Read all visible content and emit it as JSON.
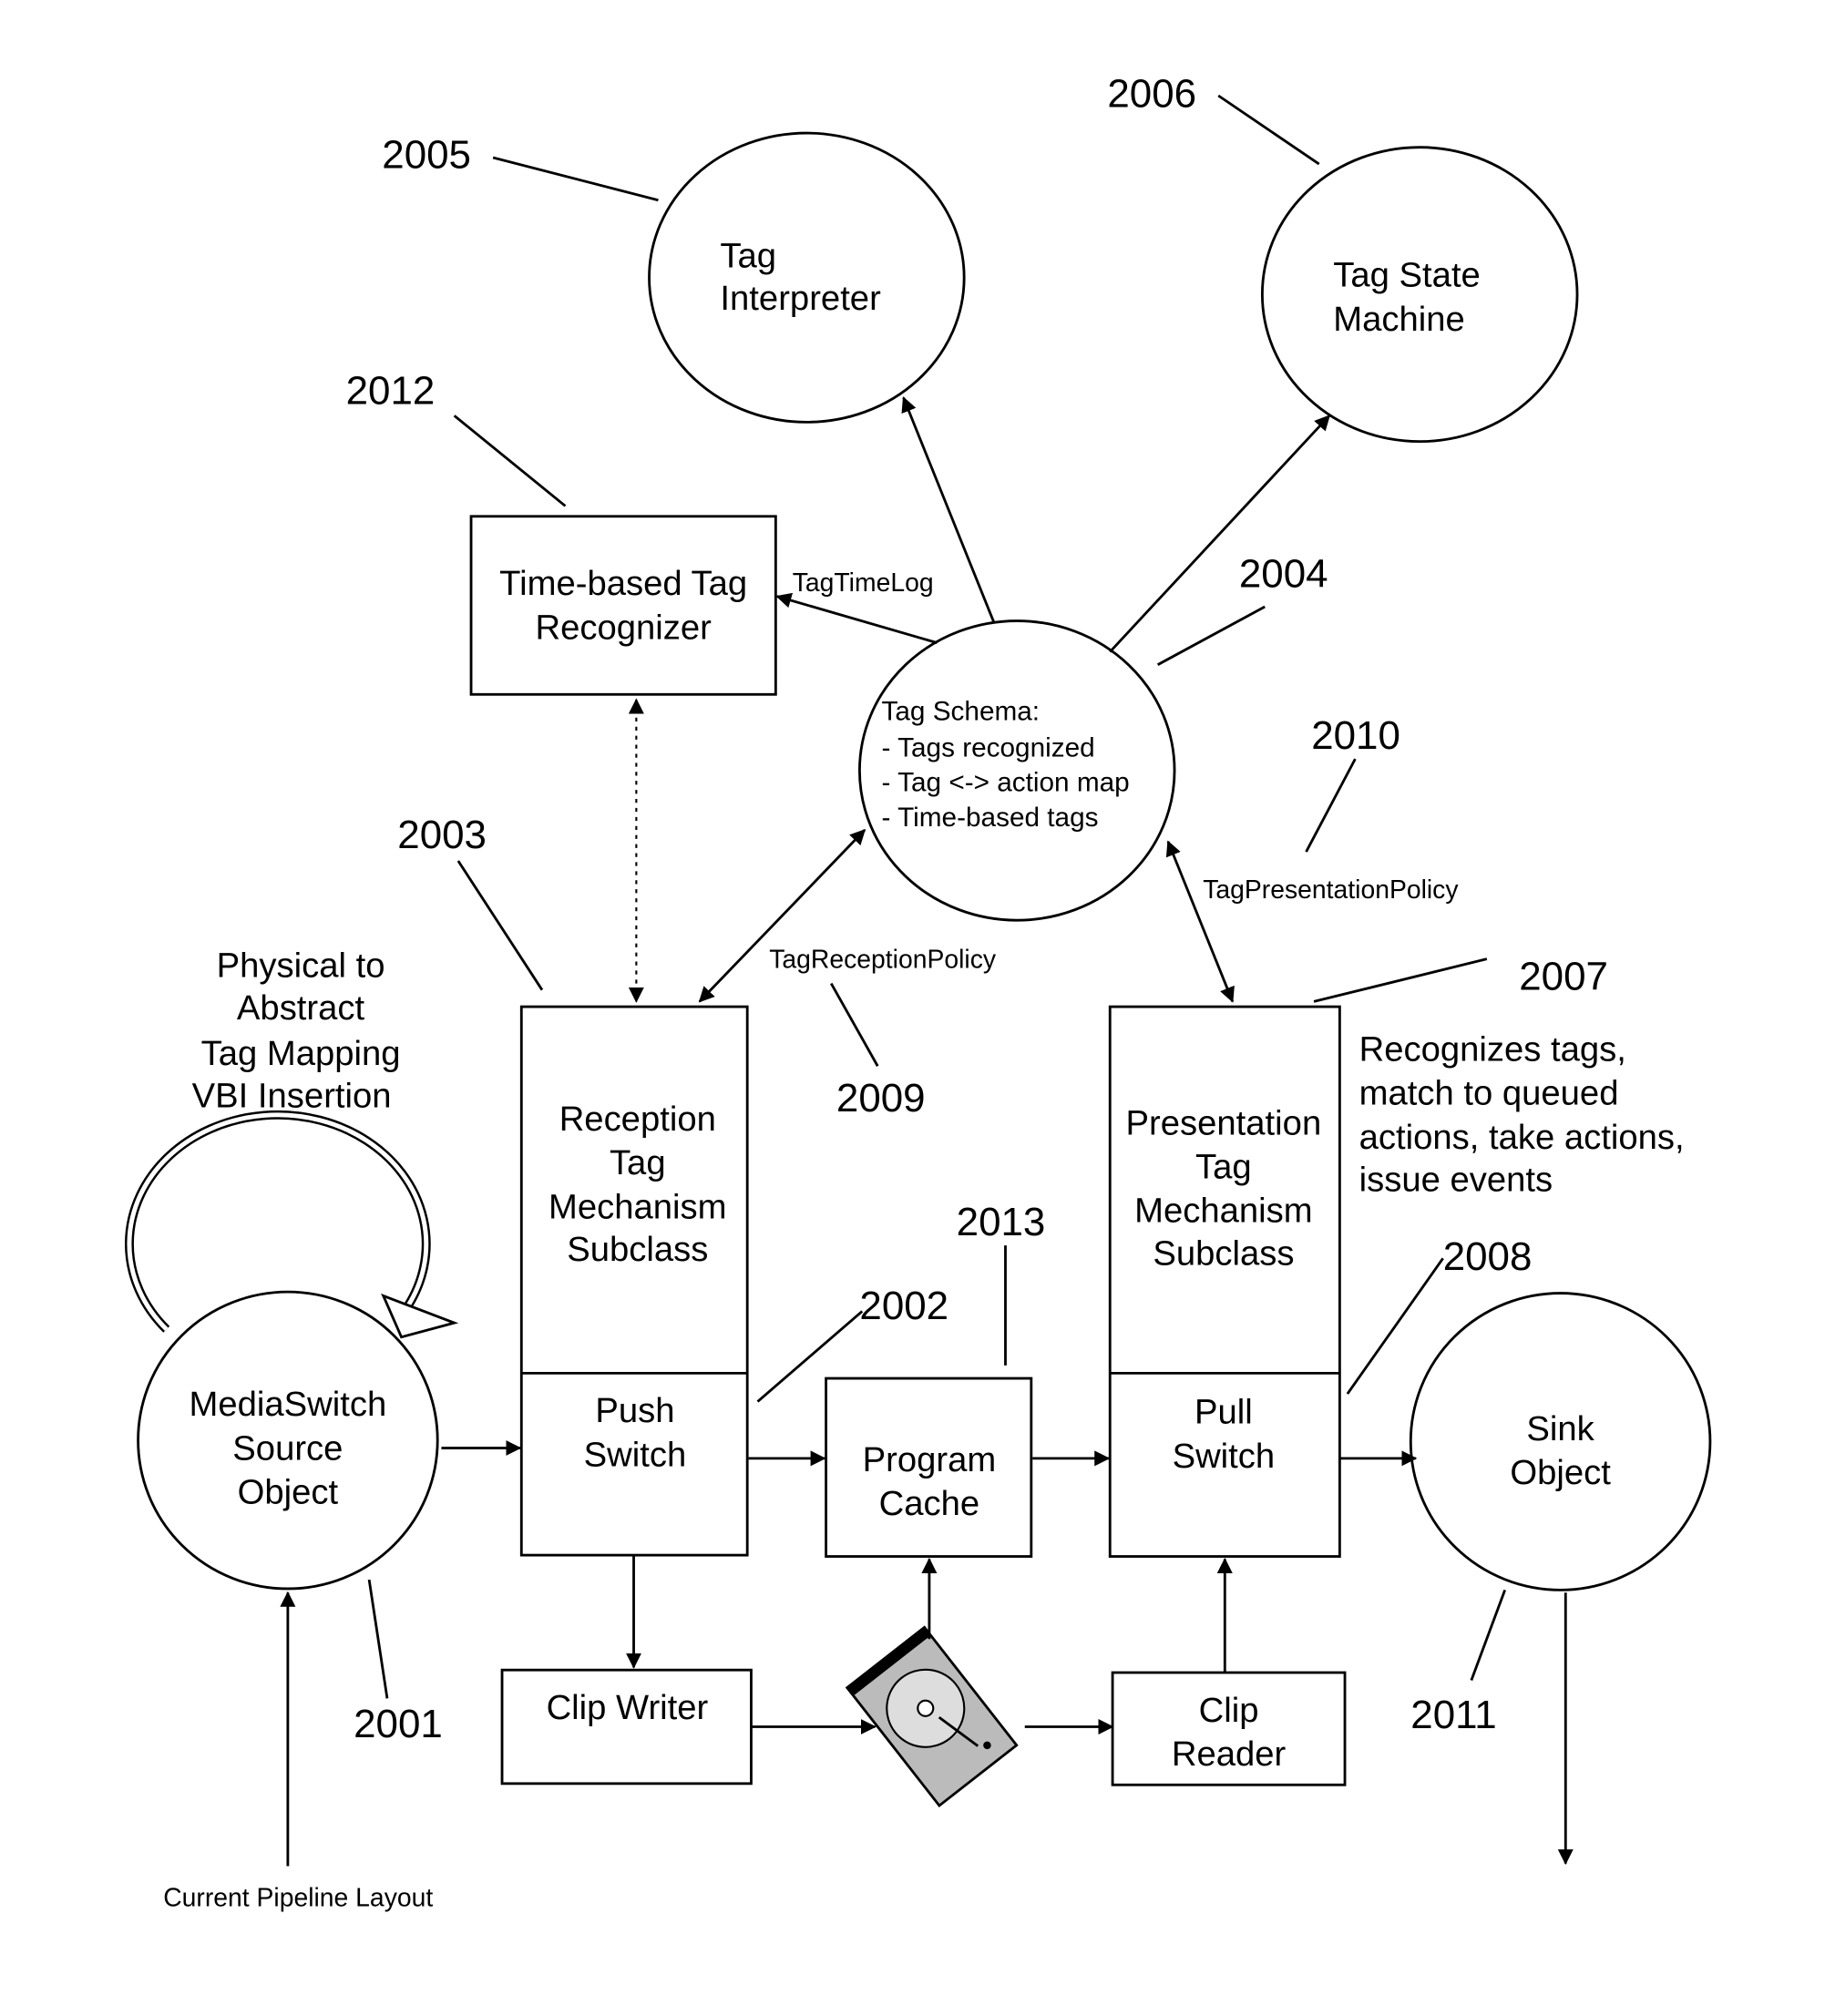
{
  "nodes": {
    "tag_interpreter": {
      "lines": [
        "Tag",
        "Interpreter"
      ],
      "ref": "2005"
    },
    "tag_state_machine": {
      "lines": [
        "Tag State",
        "Machine"
      ],
      "ref": "2006"
    },
    "time_based_recognizer": {
      "lines": [
        "Time-based Tag",
        "Recognizer"
      ],
      "ref": "2012"
    },
    "tag_schema": {
      "lines": [
        "Tag Schema:",
        "- Tags recognized",
        "- Tag <-> action map",
        "- Time-based tags"
      ],
      "ref": "2004"
    },
    "reception_mechanism": {
      "lines": [
        "Reception",
        "Tag",
        "Mechanism",
        "Subclass"
      ],
      "ref": "2003"
    },
    "push_switch": {
      "lines": [
        "Push",
        "Switch"
      ],
      "ref": "2002"
    },
    "program_cache": {
      "lines": [
        "Program",
        "Cache"
      ],
      "ref": "2013"
    },
    "presentation_mechanism": {
      "lines": [
        "Presentation",
        "Tag",
        "Mechanism",
        "Subclass"
      ],
      "ref": "2007"
    },
    "pull_switch": {
      "lines": [
        "Pull",
        "Switch"
      ],
      "ref": "2008"
    },
    "source_object": {
      "lines": [
        "MediaSwitch",
        "Source",
        "Object"
      ],
      "ref": "2001"
    },
    "sink_object": {
      "lines": [
        "Sink",
        "Object"
      ],
      "ref": "2011"
    },
    "clip_writer": {
      "lines": [
        "Clip Writer"
      ]
    },
    "clip_reader": {
      "lines": [
        "Clip",
        "Reader"
      ]
    },
    "disk": {
      "icon": "hard-disk-icon"
    }
  },
  "edge_labels": {
    "tag_time_log": "TagTimeLog",
    "tag_reception_policy": "TagReceptionPolicy",
    "reception_policy_ref": "2009",
    "tag_presentation_policy": "TagPresentationPolicy",
    "presentation_policy_ref": "2010"
  },
  "annotations": {
    "loop_label": [
      "Physical to",
      "Abstract",
      "Tag Mapping",
      "VBI Insertion"
    ],
    "presentation_note": [
      "Recognizes tags,",
      "match to queued",
      "actions, take actions,",
      "issue events"
    ],
    "bottom_caption": "Current Pipeline Layout"
  }
}
